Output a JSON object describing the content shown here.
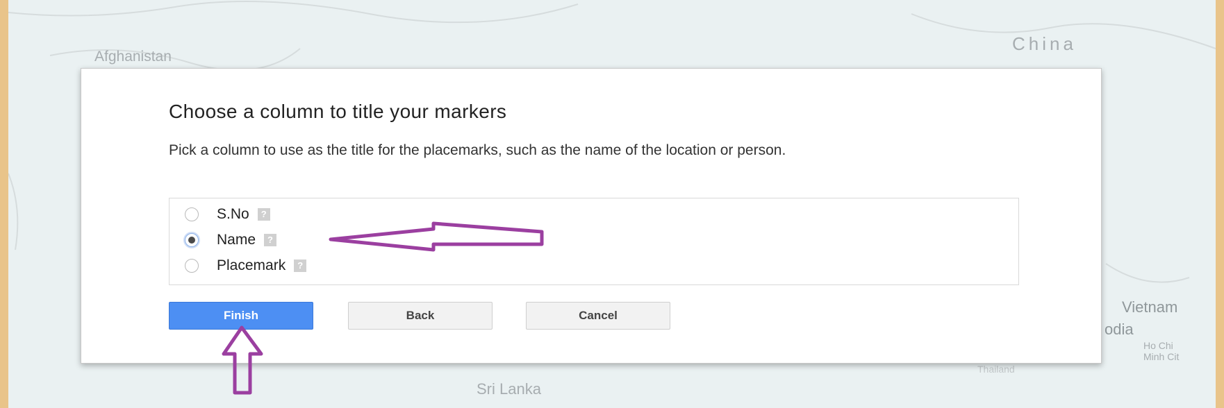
{
  "map": {
    "labels": {
      "afghanistan": "Afghanistan",
      "china": "China",
      "vietnam": "Vietnam",
      "cambodia_partial": "odia",
      "ho_chi_minh_1": "Ho Chi",
      "ho_chi_minh_2": "Minh Cit",
      "thailand": "Thailand",
      "sri_lanka": "Sri Lanka"
    }
  },
  "dialog": {
    "title": "Choose a column to title your markers",
    "description": "Pick a column to use as the title for the placemarks, such as the name of the location or person.",
    "options": [
      {
        "label": "S.No",
        "checked": false
      },
      {
        "label": "Name",
        "checked": true
      },
      {
        "label": "Placemark",
        "checked": false
      }
    ],
    "help_glyph": "?",
    "buttons": {
      "finish": "Finish",
      "back": "Back",
      "cancel": "Cancel"
    }
  },
  "colors": {
    "frame_border": "#e9c48a",
    "primary_button": "#4d8ff3",
    "annotation_arrow": "#9b3fa0"
  }
}
